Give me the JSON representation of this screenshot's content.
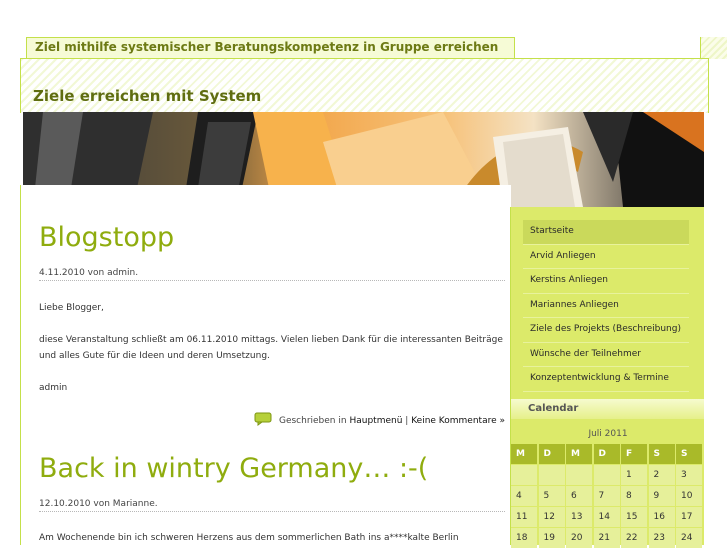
{
  "site": {
    "tagline": "Ziel mithilfe systemischer Beratungskompetenz in Gruppe erreichen",
    "title": "Ziele erreichen mit System"
  },
  "posts": [
    {
      "title": "Blogstopp",
      "meta": "4.11.2010 von admin.",
      "paragraphs": [
        "Liebe Blogger,",
        "diese Veranstaltung schließt am 06.11.2010 mittags. Vielen lieben Dank für die interessanten Beiträge und alles Gute für die Ideen und deren Umsetzung.",
        "admin"
      ],
      "footer": {
        "prefix": "Geschrieben in",
        "category": "Hauptmenü",
        "separator": "|",
        "comments": "Keine Kommentare »"
      }
    },
    {
      "title": "Back in wintry Germany… :-(",
      "meta": "12.10.2010 von Marianne.",
      "paragraphs": [
        "Am Wochenende bin ich schweren Herzens aus dem sommerlichen Bath ins a****kalte Berlin"
      ]
    }
  ],
  "sidebar": {
    "nav": [
      "Startseite",
      "Arvid Anliegen",
      "Kerstins Anliegen",
      "Mariannes Anliegen",
      "Ziele des Projekts (Beschreibung)",
      "Wünsche der Teilnehmer",
      "Konzeptentwicklung & Termine"
    ],
    "calendar": {
      "heading": "Calendar",
      "month": "Juli 2011",
      "weekdays": [
        "M",
        "D",
        "M",
        "D",
        "F",
        "S",
        "S"
      ],
      "weeks": [
        [
          "",
          "",
          "",
          "",
          "1",
          "2",
          "3"
        ],
        [
          "4",
          "5",
          "6",
          "7",
          "8",
          "9",
          "10"
        ],
        [
          "11",
          "12",
          "13",
          "14",
          "15",
          "16",
          "17"
        ],
        [
          "18",
          "19",
          "20",
          "21",
          "22",
          "23",
          "24"
        ]
      ]
    }
  },
  "colors": {
    "accent": "#8fac0e",
    "sidebar_bg": "#dcea6a",
    "calendar_header": "#a9ba29"
  }
}
